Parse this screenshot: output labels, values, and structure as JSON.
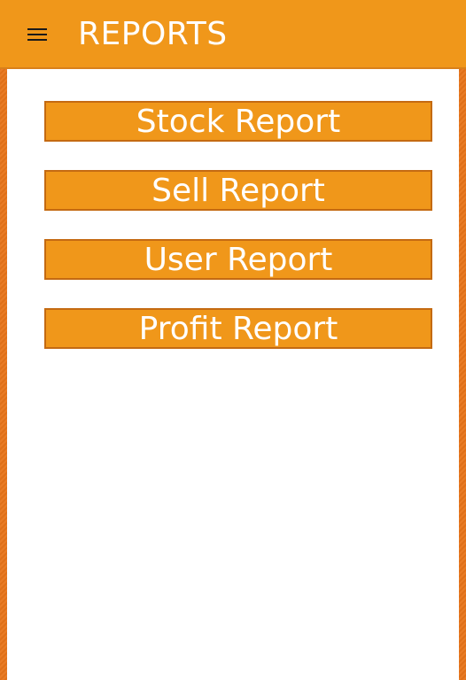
{
  "appbar": {
    "title": "REPORTS",
    "menu_icon": "hamburger-menu-icon"
  },
  "reports": {
    "buttons": [
      {
        "label": "Stock Report"
      },
      {
        "label": "Sell Report"
      },
      {
        "label": "User Report"
      },
      {
        "label": "Profit Report"
      }
    ]
  },
  "colors": {
    "accent": "#f0971a",
    "frame": "#e8751a",
    "button_border": "#c46a12"
  }
}
